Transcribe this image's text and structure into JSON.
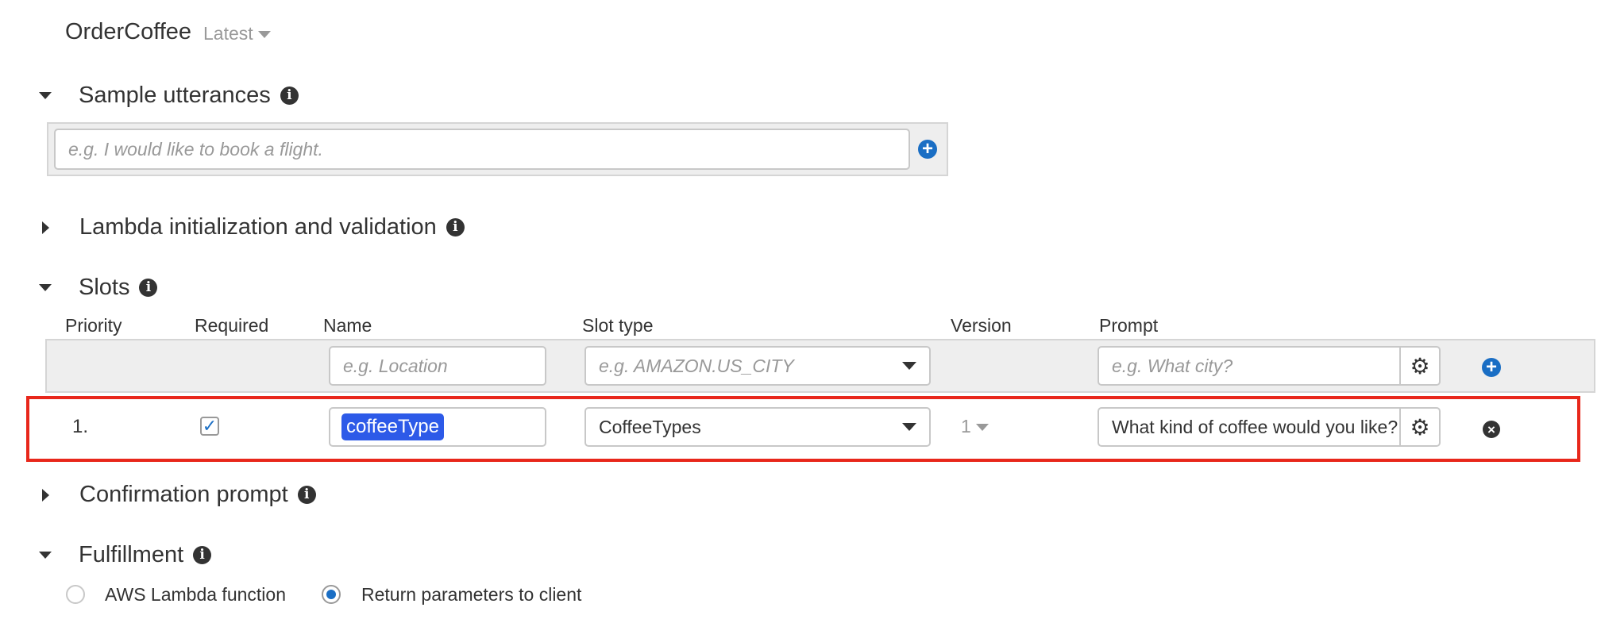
{
  "intent": {
    "name": "OrderCoffee",
    "version": "Latest"
  },
  "sections": {
    "sample_utterances": {
      "title": "Sample utterances",
      "placeholder": "e.g. I would like to book a flight."
    },
    "lambda": {
      "title": "Lambda initialization and validation"
    },
    "slots": {
      "title": "Slots",
      "headers": {
        "priority": "Priority",
        "required": "Required",
        "name": "Name",
        "slot_type": "Slot type",
        "version": "Version",
        "prompt": "Prompt"
      },
      "new_row": {
        "name_placeholder": "e.g. Location",
        "type_placeholder": "e.g. AMAZON.US_CITY",
        "prompt_placeholder": "e.g. What city?"
      },
      "rows": [
        {
          "priority": "1.",
          "required": true,
          "name": "coffeeType",
          "slot_type": "CoffeeTypes",
          "version": "1",
          "prompt": "What kind of coffee would you like?"
        }
      ]
    },
    "confirmation": {
      "title": "Confirmation prompt"
    },
    "fulfillment": {
      "title": "Fulfillment",
      "options": [
        {
          "label": "AWS Lambda function",
          "selected": false
        },
        {
          "label": "Return parameters to client",
          "selected": true
        }
      ]
    }
  },
  "icons": {
    "info": "info-icon",
    "add": "plus-circle-icon",
    "settings": "gear-icon",
    "remove": "x-circle-icon",
    "check": "checkmark-icon"
  },
  "colors": {
    "accent": "#1a6ec4",
    "highlight": "#e8271b",
    "token": "#2d5ae8"
  }
}
